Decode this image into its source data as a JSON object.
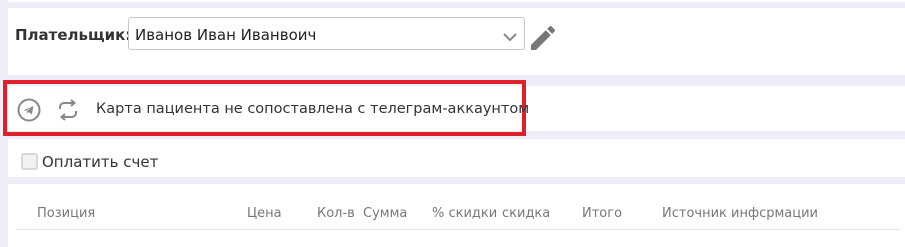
{
  "payer": {
    "label": "Плательщик:",
    "selected": "Иванов Иван Иванвоич",
    "chevron_icon": "chevron-down-icon",
    "edit_icon": "pencil-icon"
  },
  "telegram": {
    "status_text": "Карта пациента не сопоставлена с телеграм-аккаунтом",
    "telegram_icon": "telegram-icon",
    "sync_icon": "sync-icon",
    "highlight_color": "#e11f2b"
  },
  "payment": {
    "checkbox_label": "Оплатить счет",
    "checked": false
  },
  "table": {
    "columns": [
      "Позиция",
      "Цена",
      "Кол-в",
      "Сумма",
      "% скидки",
      "скидка",
      "Итого",
      "Источник инфсрмации"
    ]
  },
  "colors": {
    "background": "#eeedf8",
    "panel": "#ffffff"
  }
}
